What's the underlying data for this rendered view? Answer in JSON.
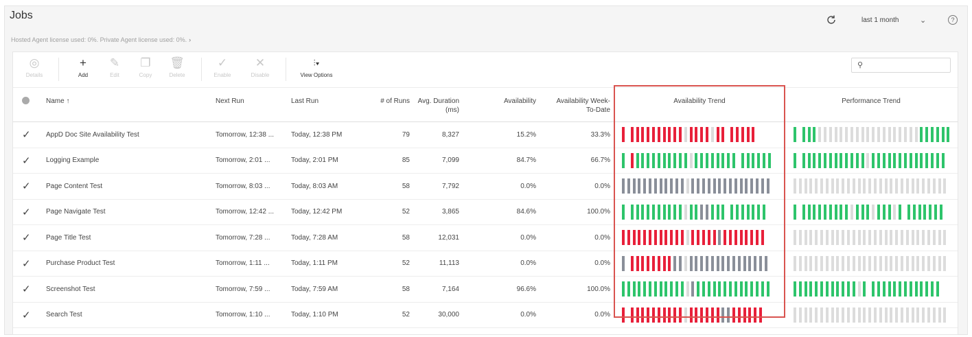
{
  "header": {
    "title": "Jobs",
    "license": "Hosted Agent license used: 0%. Private Agent license used: 0%.",
    "license_chevron": "›",
    "refresh_icon": "refresh-icon",
    "range": "last 1 month",
    "range_chevron": "⌄",
    "help": "?"
  },
  "toolbar": {
    "details": {
      "icon": "eye-icon",
      "glyph": "◎",
      "label": "Details"
    },
    "add": {
      "icon": "plus-icon",
      "glyph": "+",
      "label": "Add"
    },
    "edit": {
      "icon": "pencil-icon",
      "glyph": "✎",
      "label": "Edit"
    },
    "copy": {
      "icon": "copy-icon",
      "glyph": "❐",
      "label": "Copy"
    },
    "delete": {
      "icon": "trash-icon",
      "glyph": "🗑",
      "label": "Delete"
    },
    "enable": {
      "icon": "check-icon",
      "glyph": "✓",
      "label": "Enable"
    },
    "disable": {
      "icon": "x-icon",
      "glyph": "✕",
      "label": "Disable"
    },
    "view_options": {
      "icon": "sliders-icon",
      "glyph": "⫶▾",
      "label": "View Options"
    },
    "search_icon": "⚲",
    "search_placeholder": ""
  },
  "columns": {
    "name": "Name ↑",
    "next_run": "Next Run",
    "last_run": "Last Run",
    "runs": "# of Runs",
    "avg_duration_1": "Avg. Duration",
    "avg_duration_2": "(ms)",
    "availability": "Availability",
    "avail_week_1": "Availability Week-",
    "avail_week_2": "To-Date",
    "availability_trend": "Availability Trend",
    "performance_trend": "Performance Trend"
  },
  "colors": {
    "green": "#2ec46b",
    "red": "#e8203a",
    "dark_gray": "#8a8f99",
    "light_gray": "#dcdcdc",
    "highlight": "#d9534f"
  },
  "rows": [
    {
      "check": "✓",
      "name": "AppD Doc Site Availability Test",
      "next_run": "Tomorrow, 12:38 ...",
      "last_run": "Today, 12:38 PM",
      "runs": "79",
      "avg": "8,327",
      "availability": "15.2%",
      "week": "33.3%",
      "avail_trend": "RxRRRRRRRRRR.RRRR.RRxRRRRR",
      "perf_trend": "GxGGG...................GGGGGG"
    },
    {
      "check": "✓",
      "name": "Logging Example",
      "next_run": "Tomorrow, 2:01 ...",
      "last_run": "Today, 2:01 PM",
      "runs": "85",
      "avg": "7,099",
      "availability": "84.7%",
      "week": "66.7%",
      "avail_trend": "GxRGGGGGGGGGG.GGGGGGGGxGGGGGG",
      "perf_trend": "GxGGGGGGGGGGGG.GGGGGGGGGGGGGG"
    },
    {
      "check": "✓",
      "name": "Page Content Test",
      "next_run": "Tomorrow, 8:03 ...",
      "last_run": "Today, 8:03 AM",
      "runs": "58",
      "avg": "7,792",
      "availability": "0.0%",
      "week": "0.0%",
      "avail_trend": "DDDDDDDDDDDD.DDDDDDDDDDDDDDD",
      "perf_trend": "............................."
    },
    {
      "check": "✓",
      "name": "Page Navigate Test",
      "next_run": "Tomorrow, 12:42 ...",
      "last_run": "Today, 12:42 PM",
      "runs": "52",
      "avg": "3,865",
      "availability": "84.6%",
      "week": "100.0%",
      "avail_trend": "GxGGGGGGGGGG.GGDDGGGxGGGGGGG",
      "perf_trend": "GxGGGGGGGGG.GGG.GGG.GxGGGGGGG"
    },
    {
      "check": "✓",
      "name": "Page Title Test",
      "next_run": "Tomorrow, 7:28 ...",
      "last_run": "Today, 7:28 AM",
      "runs": "58",
      "avg": "12,031",
      "availability": "0.0%",
      "week": "0.0%",
      "avail_trend": "RRRRRRRRRRRR.RRRRRDRRRRRRRR",
      "perf_trend": "............................."
    },
    {
      "check": "✓",
      "name": "Purchase Product Test",
      "next_run": "Tomorrow, 1:11 ...",
      "last_run": "Today, 1:11 PM",
      "runs": "52",
      "avg": "11,113",
      "availability": "0.0%",
      "week": "0.0%",
      "avail_trend": "DxRRRRRRRRDD.DDDDDDDDDDDDDDD",
      "perf_trend": "............................."
    },
    {
      "check": "✓",
      "name": "Screenshot Test",
      "next_run": "Tomorrow, 7:59 ...",
      "last_run": "Today, 7:59 AM",
      "runs": "58",
      "avg": "7,164",
      "availability": "96.6%",
      "week": "100.0%",
      "avail_trend": "GGGGGGGGGGGG.DGGGGGGGGGGGGGG",
      "perf_trend": "GGGGGGGGGGGG.GxGGGGGGGGGGGGG"
    },
    {
      "check": "✓",
      "name": "Search Test",
      "next_run": "Tomorrow, 1:10 ...",
      "last_run": "Today, 1:10 PM",
      "runs": "52",
      "avg": "30,000",
      "availability": "0.0%",
      "week": "0.0%",
      "avail_trend": "RxRRRRRRRRRR.RRRRRRDDRRRRRR",
      "perf_trend": "............................."
    }
  ]
}
